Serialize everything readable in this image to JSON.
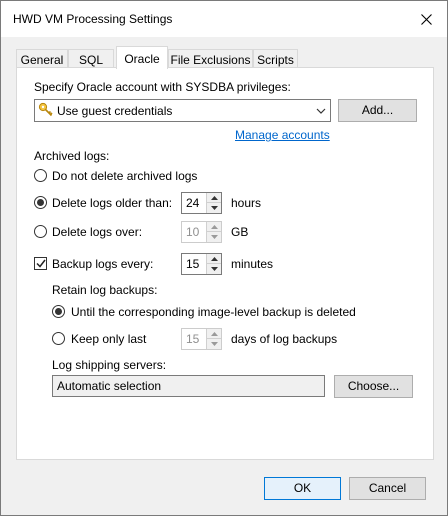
{
  "window": {
    "title": "HWD VM Processing Settings"
  },
  "tabs": [
    {
      "label": "General"
    },
    {
      "label": "SQL"
    },
    {
      "label": "Oracle"
    },
    {
      "label": "File Exclusions"
    },
    {
      "label": "Scripts"
    }
  ],
  "account": {
    "label": "Specify Oracle account with SYSDBA privileges:",
    "selected": "Use guest credentials",
    "add_button": "Add...",
    "manage_link": "Manage accounts"
  },
  "archived": {
    "heading": "Archived logs:",
    "opt_do_not_delete": "Do not delete archived logs",
    "opt_delete_older": "Delete logs older than:",
    "older_value": "24",
    "older_unit": "hours",
    "opt_delete_over": "Delete logs over:",
    "over_value": "10",
    "over_unit": "GB"
  },
  "backup": {
    "label": "Backup logs every:",
    "value": "15",
    "unit": "minutes",
    "retain_heading": "Retain log backups:",
    "opt_until": "Until the corresponding image-level backup is deleted",
    "opt_keep": "Keep only last",
    "keep_value": "15",
    "keep_unit": "days of log backups",
    "shipping_label": "Log shipping servers:",
    "shipping_value": "Automatic selection",
    "choose_button": "Choose..."
  },
  "footer": {
    "ok": "OK",
    "cancel": "Cancel"
  }
}
